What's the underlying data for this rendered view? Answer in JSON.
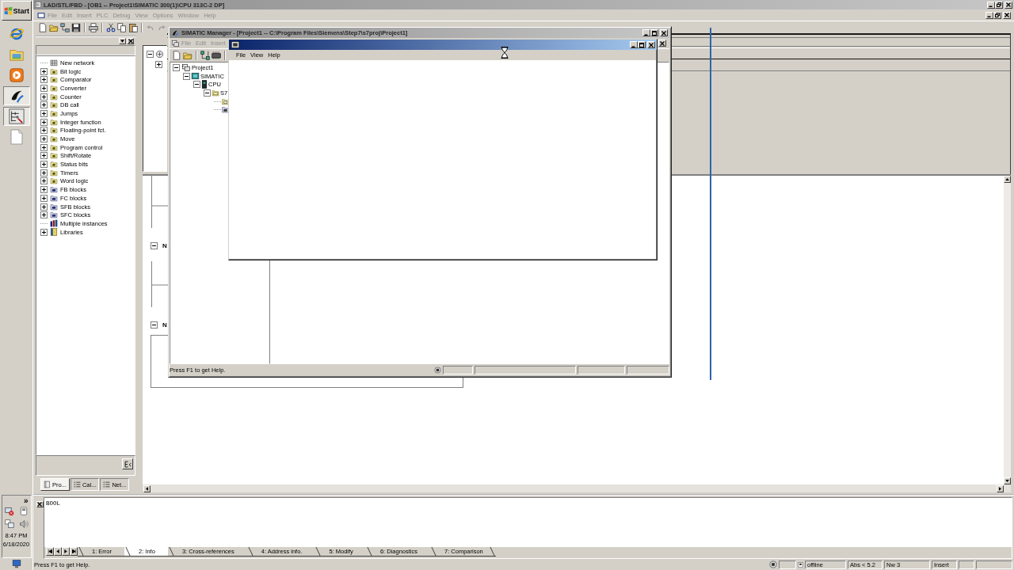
{
  "taskbar": {
    "start": "Start",
    "buttons": [
      {
        "kind": "browser",
        "selected": false
      },
      {
        "kind": "explorer",
        "selected": false
      },
      {
        "kind": "media",
        "selected": false
      },
      {
        "kind": "simatic",
        "selected": true
      },
      {
        "kind": "ladder",
        "selected": true
      },
      {
        "kind": "document",
        "selected": false
      }
    ],
    "tray": {
      "chevron": "»",
      "time": "8:47 PM",
      "date": "6/18/2020"
    }
  },
  "main_window": {
    "title": "LAD/STL/FBD - [OB1 -- Project1\\SIMATIC 300(1)\\CPU 313C-2 DP]",
    "menu": [
      {
        "label": "File",
        "disabled": true
      },
      {
        "label": "Edit",
        "disabled": true
      },
      {
        "label": "Insert",
        "disabled": true
      },
      {
        "label": "PLC",
        "disabled": true
      },
      {
        "label": "Debug",
        "disabled": true
      },
      {
        "label": "View",
        "disabled": true
      },
      {
        "label": "Options",
        "disabled": true
      },
      {
        "label": "Window",
        "disabled": true
      },
      {
        "label": "Help",
        "disabled": true
      }
    ],
    "catalog": {
      "items": [
        {
          "kind": "network",
          "label": "New network"
        },
        {
          "kind": "folder",
          "label": "Bit logic",
          "expanded": false
        },
        {
          "kind": "folder",
          "label": "Comparator",
          "expanded": false
        },
        {
          "kind": "folder",
          "label": "Converter",
          "expanded": false
        },
        {
          "kind": "folder",
          "label": "Counter",
          "expanded": false
        },
        {
          "kind": "folder",
          "label": "DB call",
          "expanded": false
        },
        {
          "kind": "folder",
          "label": "Jumps",
          "expanded": false
        },
        {
          "kind": "folder",
          "label": "Integer function",
          "expanded": false
        },
        {
          "kind": "folder",
          "label": "Floating-point fct.",
          "expanded": false
        },
        {
          "kind": "folder",
          "label": "Move",
          "expanded": false
        },
        {
          "kind": "folder",
          "label": "Program control",
          "expanded": false
        },
        {
          "kind": "folder",
          "label": "Shift/Rotate",
          "expanded": false
        },
        {
          "kind": "folder",
          "label": "Status bits",
          "expanded": false
        },
        {
          "kind": "folder",
          "label": "Timers",
          "expanded": false
        },
        {
          "kind": "folder",
          "label": "Word logic",
          "expanded": false
        },
        {
          "kind": "block",
          "label": "FB blocks",
          "expanded": false
        },
        {
          "kind": "block",
          "label": "FC blocks",
          "expanded": false
        },
        {
          "kind": "block",
          "label": "SFB blocks",
          "expanded": false
        },
        {
          "kind": "block",
          "label": "SFC blocks",
          "expanded": false
        },
        {
          "kind": "instances",
          "label": "Multiple instances"
        },
        {
          "kind": "library",
          "label": "Libraries",
          "expanded": false
        }
      ],
      "tabs": [
        {
          "label": "Pro...",
          "selected": true
        },
        {
          "label": "Cal...",
          "selected": false
        },
        {
          "label": "Net...",
          "selected": false
        }
      ]
    },
    "editor": {
      "overview": [
        {
          "expanded": true,
          "children": [
            {
              "expanded": false
            }
          ]
        }
      ],
      "networks": [
        {
          "title": "N",
          "expanded": true
        },
        {
          "title": "N",
          "expanded": true
        }
      ]
    },
    "details": {
      "text": "BOOL",
      "tabs": [
        {
          "label": "1: Error",
          "selected": false
        },
        {
          "label": "2: Info",
          "selected": true
        },
        {
          "label": "3: Cross-references",
          "selected": false
        },
        {
          "label": "4: Address info.",
          "selected": false
        },
        {
          "label": "5: Modify",
          "selected": false
        },
        {
          "label": "6: Diagnostics",
          "selected": false
        },
        {
          "label": "7: Comparison",
          "selected": false
        }
      ]
    },
    "status_bar": {
      "hint": "Press F1 to get Help.",
      "mode": "offline",
      "address": "Abs < 5.2",
      "network": "Nw 3",
      "edit_mode": "Insert"
    }
  },
  "simatic_manager": {
    "title": "SIMATIC Manager - [Project1 -- C:\\Program Files\\Siemens\\Step7\\s7proj\\Project1]",
    "menu": [
      {
        "label": "File",
        "disabled": true
      },
      {
        "label": "Edit",
        "disabled": true
      },
      {
        "label": "Insert",
        "disabled": true
      }
    ],
    "tree": [
      {
        "kind": "project",
        "label": "Project1",
        "expanded": true,
        "children": [
          {
            "kind": "station",
            "label": "SIMATIC",
            "expanded": true,
            "children": [
              {
                "kind": "cpu",
                "label": "CPU",
                "expanded": true,
                "children": [
                  {
                    "kind": "program",
                    "label": "S7",
                    "expanded": true,
                    "children": [
                      {
                        "kind": "sources"
                      },
                      {
                        "kind": "blocks"
                      }
                    ]
                  }
                ]
              }
            ]
          }
        ]
      }
    ],
    "status_bar": "Press F1 to get Help."
  },
  "dialog": {
    "menu": [
      {
        "label": "File",
        "disabled": false
      },
      {
        "label": "View",
        "disabled": false
      },
      {
        "label": "Help",
        "disabled": false
      }
    ]
  }
}
